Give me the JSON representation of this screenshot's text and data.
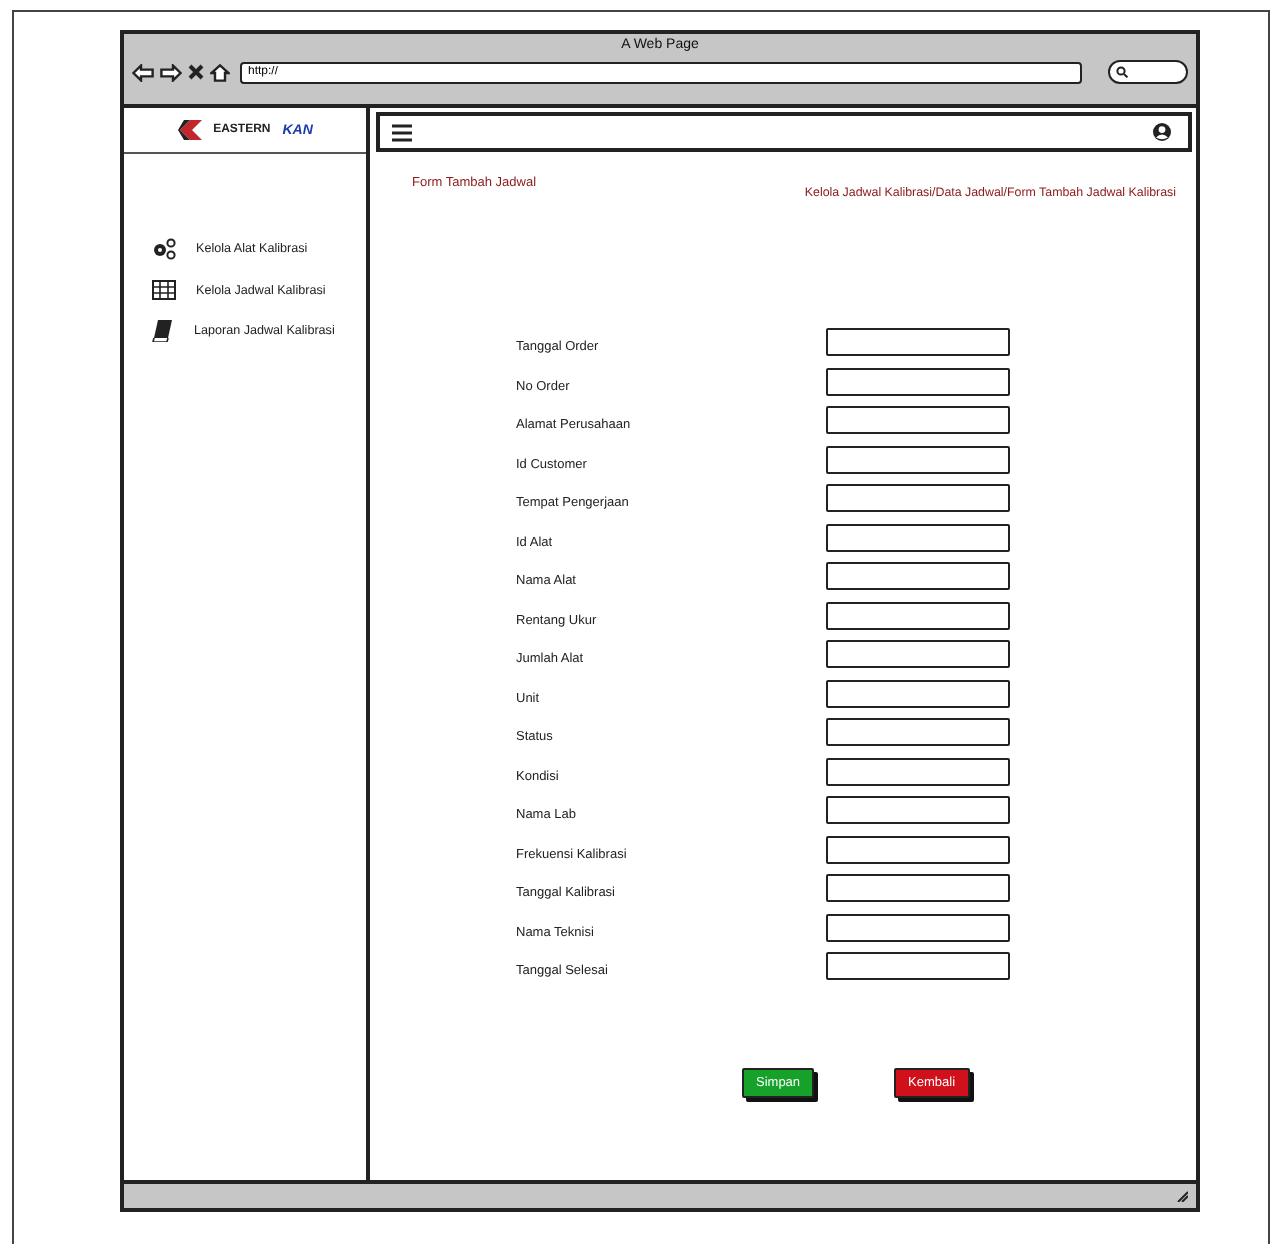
{
  "window": {
    "title": "A Web Page",
    "url": "http://"
  },
  "logo": {
    "name": "EASTERN",
    "partner": "KAN"
  },
  "sidebar": {
    "items": [
      {
        "label": "Kelola Alat Kalibrasi",
        "kind": "gears"
      },
      {
        "label": "Kelola Jadwal Kalibrasi",
        "kind": "table"
      },
      {
        "label": "Laporan Jadwal Kalibrasi",
        "kind": "book"
      }
    ]
  },
  "page": {
    "title": "Form Tambah Jadwal",
    "breadcrumb": "Kelola Jadwal Kalibrasi/Data Jadwal/Form Tambah Jadwal Kalibrasi"
  },
  "form": {
    "fields": [
      "Tanggal Order",
      "No Order",
      "Alamat Perusahaan",
      "Id Customer",
      "Tempat Pengerjaan",
      "Id Alat",
      "Nama Alat",
      "Rentang Ukur",
      "Jumlah Alat",
      "Unit",
      "Status",
      "Kondisi",
      "Nama Lab",
      "Frekuensi Kalibrasi",
      "Tanggal Kalibrasi",
      "Nama Teknisi",
      "Tanggal Selesai"
    ],
    "buttons": [
      {
        "label": "Simpan",
        "color": "#16a12a"
      },
      {
        "label": "Kembali",
        "color": "#d0101a"
      }
    ]
  }
}
